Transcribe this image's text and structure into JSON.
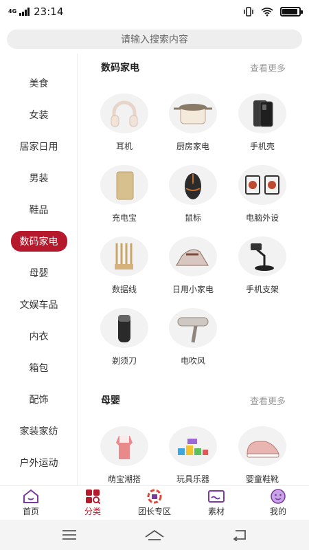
{
  "status": {
    "network": "4G",
    "time": "23:14"
  },
  "search": {
    "placeholder": "请输入搜索内容"
  },
  "sidebar": {
    "items": [
      {
        "label": "美食"
      },
      {
        "label": "女装"
      },
      {
        "label": "居家日用"
      },
      {
        "label": "男装"
      },
      {
        "label": "鞋品"
      },
      {
        "label": "数码家电",
        "active": true
      },
      {
        "label": "母婴"
      },
      {
        "label": "文娱车品"
      },
      {
        "label": "内衣"
      },
      {
        "label": "箱包"
      },
      {
        "label": "配饰"
      },
      {
        "label": "家装家纺"
      },
      {
        "label": "户外运动"
      }
    ]
  },
  "sections": [
    {
      "title": "数码家电",
      "more": "查看更多",
      "items": [
        {
          "label": "耳机",
          "icon": "headphones-icon"
        },
        {
          "label": "厨房家电",
          "icon": "cooker-icon"
        },
        {
          "label": "手机壳",
          "icon": "phone-case-icon"
        },
        {
          "label": "充电宝",
          "icon": "power-bank-icon"
        },
        {
          "label": "鼠标",
          "icon": "mouse-icon"
        },
        {
          "label": "电脑外设",
          "icon": "speakers-icon"
        },
        {
          "label": "数据线",
          "icon": "cable-icon"
        },
        {
          "label": "日用小家电",
          "icon": "iron-icon"
        },
        {
          "label": "手机支架",
          "icon": "phone-stand-icon"
        },
        {
          "label": "剃须刀",
          "icon": "shaver-icon"
        },
        {
          "label": "电吹风",
          "icon": "hair-dryer-icon"
        }
      ]
    },
    {
      "title": "母婴",
      "more": "查看更多",
      "items": [
        {
          "label": "萌宝潮搭",
          "icon": "baby-dress-icon"
        },
        {
          "label": "玩具乐器",
          "icon": "toy-blocks-icon"
        },
        {
          "label": "婴童鞋靴",
          "icon": "baby-shoe-icon"
        }
      ]
    }
  ],
  "tabbar": {
    "items": [
      {
        "label": "首页",
        "icon": "home-icon"
      },
      {
        "label": "分类",
        "icon": "category-icon",
        "active": true
      },
      {
        "label": "团长专区",
        "icon": "leader-zone-icon"
      },
      {
        "label": "素材",
        "icon": "material-icon"
      },
      {
        "label": "我的",
        "icon": "profile-icon"
      }
    ]
  },
  "colors": {
    "accent": "#b5192b",
    "purple": "#7b3aa0"
  }
}
